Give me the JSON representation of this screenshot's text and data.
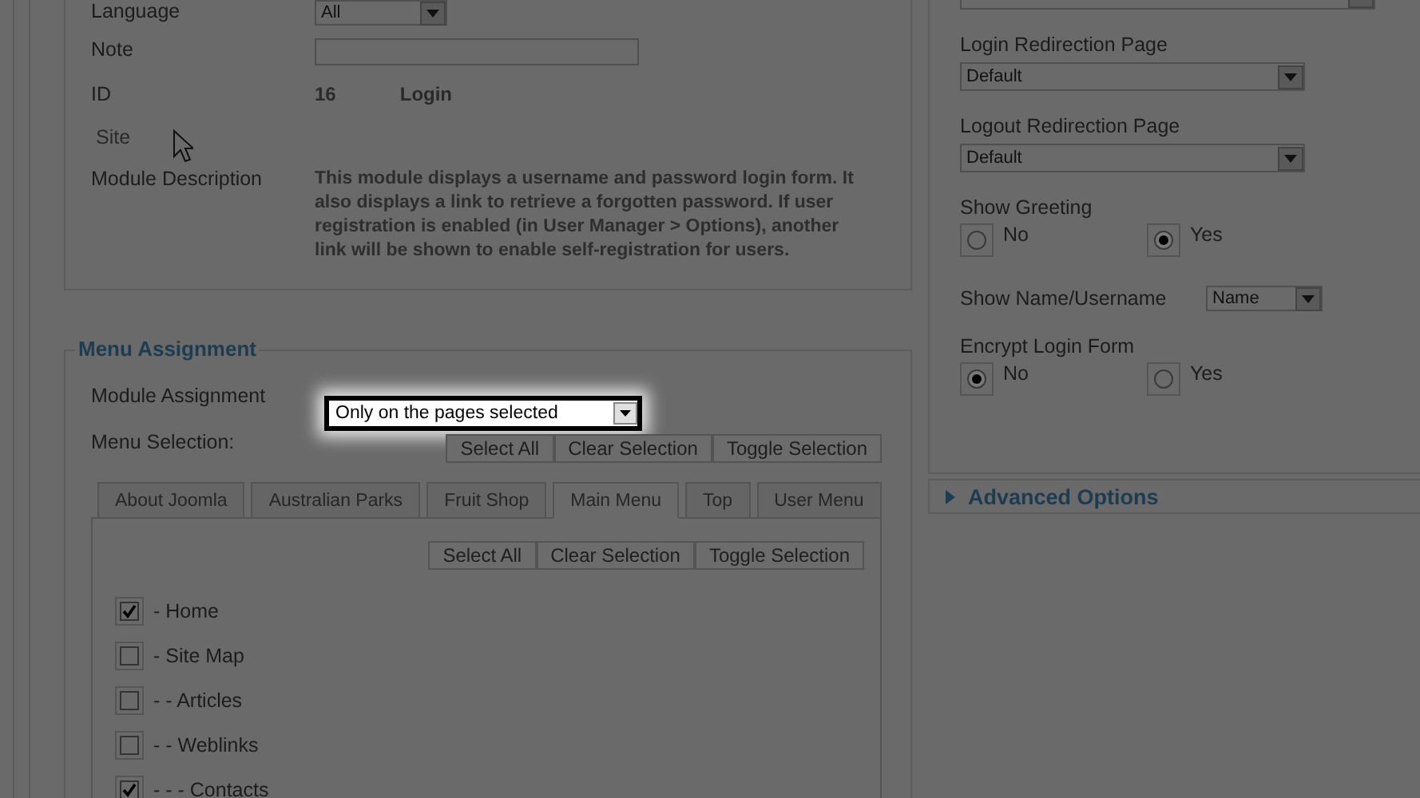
{
  "details": {
    "rows": [
      {
        "kind": "select",
        "label": "Language",
        "value": "All"
      },
      {
        "kind": "input",
        "label": "Note"
      },
      {
        "kind": "id",
        "label": "ID",
        "value": "16",
        "extra": "Login"
      },
      {
        "kind": "plain",
        "label": "Site"
      },
      {
        "kind": "text",
        "label": "Module Description",
        "value": "This module displays a username and password login form. It also displays a link to retrieve a forgotten password. If user registration is enabled (in User Manager > Options), another link will be shown to enable self-registration for users."
      }
    ]
  },
  "menu_assignment": {
    "title": "Menu Assignment",
    "module_assignment": {
      "label": "Module Assignment",
      "value": "Only on the pages selected"
    },
    "menu_selection_label": "Menu Selection:",
    "buttons": [
      "Select All",
      "Clear Selection",
      "Toggle Selection"
    ],
    "tabs": [
      {
        "label": "About Joomla",
        "selected": false
      },
      {
        "label": "Australian Parks",
        "selected": false
      },
      {
        "label": "Fruit Shop",
        "selected": false
      },
      {
        "label": "Main Menu",
        "selected": true
      },
      {
        "label": "Top",
        "selected": false
      },
      {
        "label": "User Menu",
        "selected": false
      }
    ],
    "tab_buttons": [
      "Select All",
      "Clear Selection",
      "Toggle Selection"
    ],
    "items": [
      {
        "label": "- Home",
        "checked": true
      },
      {
        "label": "- Site Map",
        "checked": false
      },
      {
        "label": "- - Articles",
        "checked": false
      },
      {
        "label": "- - Weblinks",
        "checked": false
      },
      {
        "label": "- - - Contacts",
        "checked": true
      }
    ]
  },
  "options": {
    "fields": [
      {
        "kind": "select"
      },
      {
        "kind": "select",
        "label": "Login Redirection Page",
        "value": "Default"
      },
      {
        "kind": "select",
        "label": "Logout Redirection Page",
        "value": "Default"
      },
      {
        "kind": "radio",
        "label": "Show Greeting",
        "options": [
          {
            "label": "No",
            "selected": false
          },
          {
            "label": "Yes",
            "selected": true
          }
        ]
      },
      {
        "kind": "inline_select",
        "label": "Show Name/Username",
        "value": "Name"
      },
      {
        "kind": "radio",
        "label": "Encrypt Login Form",
        "options": [
          {
            "label": "No",
            "selected": true
          },
          {
            "label": "Yes",
            "selected": false
          }
        ]
      }
    ]
  },
  "advanced": {
    "title": "Advanced Options",
    "expanded": false
  }
}
